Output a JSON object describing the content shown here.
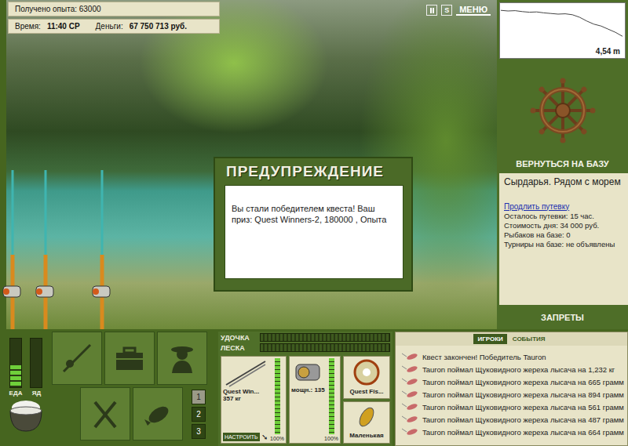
{
  "stats": {
    "experience": "Получено опыта: 63000",
    "time_label": "Время:",
    "time": "11:40 СР",
    "money_label": "Деньги:",
    "money": "67 750 713 руб."
  },
  "menu": {
    "sound": "S",
    "menu": "МЕНЮ"
  },
  "modal": {
    "title": "ПРЕДУПРЕЖДЕНИЕ",
    "message": "Вы стали победителем квеста! Ваш приз: Quest Winners-2, 180000 , Опыта"
  },
  "depth_chart": {
    "reading": "4,54 m",
    "values": [
      0.4,
      0.5,
      0.45,
      0.6,
      0.7,
      0.65,
      0.8,
      0.9,
      1.0,
      0.95,
      1.1,
      1.5,
      2.1,
      2.6,
      2.9,
      3.4,
      3.9,
      4.54
    ]
  },
  "base": {
    "action": "ВЕРНУТЬСЯ НА БАЗУ",
    "location": "Сырдарья. Рядом с морем",
    "extend_link": "Продлить путевку",
    "details": [
      "Осталось путевки: 15 час.",
      "Стоимость дня: 34 000 руб.",
      "Рыбаков на базе: 0",
      "Турниры на базе: не объявлены"
    ],
    "bans": "ЗАПРЕТЫ"
  },
  "meters": [
    {
      "label": "ЕДА",
      "level": 0.45
    },
    {
      "label": "ЯД",
      "level": 0
    }
  ],
  "pages": [
    {
      "label": "1",
      "selected": true
    },
    {
      "label": "2",
      "selected": false
    },
    {
      "label": "3",
      "selected": false
    }
  ],
  "gauges": [
    {
      "label": "УДОЧКА",
      "level": 0
    },
    {
      "label": "ЛЕСКА",
      "level": 0
    }
  ],
  "tackle": {
    "rod": {
      "name": "Quest Win...",
      "weight": "357 кг",
      "condition": "100%",
      "level": 1
    },
    "setup": "НАСТРОИТЬ",
    "reel": {
      "power": "мощн.: 135",
      "condition": "100%",
      "level": 1
    },
    "line": {
      "name": "Quest Fis..."
    },
    "lure": {
      "name": "Маленькая"
    }
  },
  "feed": {
    "tabs": [
      {
        "label": "ИГРОКИ",
        "selected": true
      },
      {
        "label": "СОБЫТИЯ",
        "selected": false
      }
    ],
    "messages": [
      "Квест закончен! Победитель Tauron",
      "Tauron поймал Щуковидного жереха лысача на 1,232 кг",
      "Tauron поймал Щуковидного жереха лысача на 665 грамм",
      "Tauron поймал Щуковидного жереха лысача на 894 грамм",
      "Tauron поймал Щуковидного жереха лысача на 561 грамм",
      "Tauron поймал Щуковидного жереха лысача на 487 грамм",
      "Tauron поймал Щуковидного жереха лысача на 664 грамм"
    ]
  }
}
